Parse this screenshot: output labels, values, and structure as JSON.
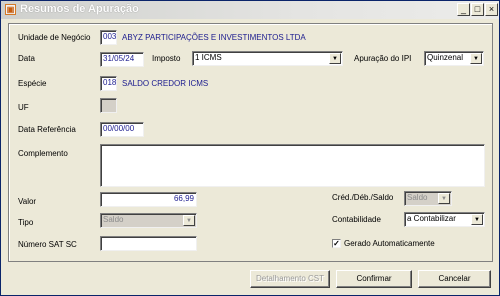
{
  "window": {
    "title": "Resumos de Apuração",
    "icon": "app-icon",
    "controls": {
      "minimize": "_",
      "maximize": "□",
      "close": "×"
    }
  },
  "form": {
    "unidade_negocio": {
      "label": "Unidade de Negócio",
      "code": "003",
      "name": "ABYZ PARTICIPAÇÕES E INVESTIMENTOS LTDA"
    },
    "data": {
      "label": "Data",
      "value": "31/05/24"
    },
    "imposto": {
      "label": "Imposto",
      "value": "1 ICMS"
    },
    "apuracao_ipi": {
      "label": "Apuração do IPI",
      "value": "Quinzenal"
    },
    "especie": {
      "label": "Espécie",
      "code": "018",
      "name": "SALDO CREDOR ICMS"
    },
    "uf": {
      "label": "UF",
      "value": ""
    },
    "data_referencia": {
      "label": "Data Referência",
      "value": "00/00/00"
    },
    "complemento": {
      "label": "Complemento",
      "value": ""
    },
    "valor": {
      "label": "Valor",
      "value": "66,99"
    },
    "tipo": {
      "label": "Tipo",
      "value": "Saldo"
    },
    "numero_sat_sc": {
      "label": "Número SAT SC",
      "value": ""
    },
    "cred_deb_saldo": {
      "label": "Créd./Déb./Saldo",
      "value": "Saldo"
    },
    "contabilidade": {
      "label": "Contabilidade",
      "value": "a Contabilizar"
    },
    "gerado_automaticamente": {
      "label": "Gerado Automaticamente",
      "checked": true
    }
  },
  "buttons": {
    "detalhamento": "Detalhamento CST",
    "confirmar": "Confirmar",
    "cancelar": "Cancelar"
  }
}
